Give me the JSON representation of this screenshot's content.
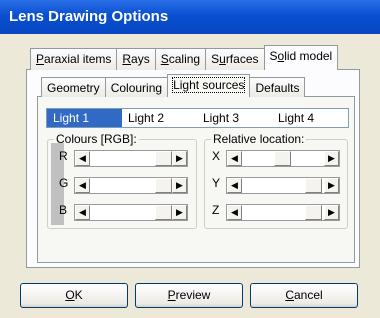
{
  "window": {
    "title": "Lens Drawing Options"
  },
  "main_tabs": [
    {
      "label": "Paraxial items",
      "key": "P"
    },
    {
      "label": "Rays",
      "key": "R"
    },
    {
      "label": "Scaling",
      "key": "S"
    },
    {
      "label": "Surfaces",
      "key": "u"
    },
    {
      "label": "Solid model",
      "key": "o",
      "active": true
    }
  ],
  "sub_tabs": [
    {
      "label": "Geometry"
    },
    {
      "label": "Colouring"
    },
    {
      "label": "Light sources",
      "active": true
    },
    {
      "label": "Defaults"
    }
  ],
  "lights": [
    "Light 1",
    "Light 2",
    "Light 3",
    "Light 4"
  ],
  "selected_light": "Light 1",
  "colours_group": {
    "label": "Colours [RGB]:",
    "rows": [
      {
        "label": "R",
        "level": 0.88
      },
      {
        "label": "G",
        "level": 0.88
      },
      {
        "label": "B",
        "level": 0.88
      }
    ]
  },
  "location_group": {
    "label": "Relative location:",
    "rows": [
      {
        "label": "X",
        "level": 0.35
      },
      {
        "label": "Y",
        "level": 0.8
      },
      {
        "label": "Z",
        "level": 0.8
      }
    ]
  },
  "buttons": {
    "ok": {
      "label": "OK",
      "key": "O"
    },
    "preview": {
      "label": "Preview",
      "key": "P"
    },
    "cancel": {
      "label": "Cancel",
      "key": "C"
    }
  }
}
